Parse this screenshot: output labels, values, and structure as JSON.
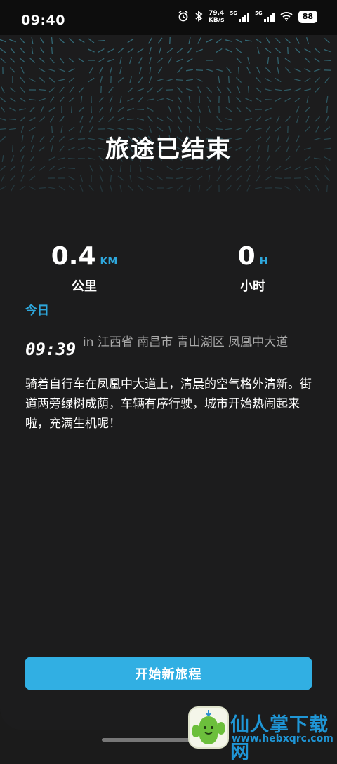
{
  "status_bar": {
    "time": "09:40",
    "speed_value": "79.4",
    "speed_unit": "KB/s",
    "sim1": "5G",
    "sim2": "5G",
    "battery": "88"
  },
  "trip": {
    "title": "旅途已结束",
    "distance": {
      "value": "0.4",
      "unit": "KM",
      "label": "公里"
    },
    "duration": {
      "value": "0",
      "unit": "H",
      "label": "小时"
    }
  },
  "log": {
    "day_label": "今日",
    "entry": {
      "time": "09:39",
      "location": "in 江西省 南昌市 青山湖区 凤凰中大道",
      "text": "骑着自行车在凤凰中大道上，清晨的空气格外清新。街道两旁绿树成荫，车辆有序行驶，城市开始热闹起来啦，充满生机呢！"
    }
  },
  "actions": {
    "start_new_trip": "开始新旅程"
  },
  "watermark": {
    "title": "仙人掌下载网",
    "url": "www.hebxqrc.com"
  },
  "colors": {
    "accent": "#2ea7dc",
    "button": "#31afe3",
    "background": "#1c1c1d"
  }
}
